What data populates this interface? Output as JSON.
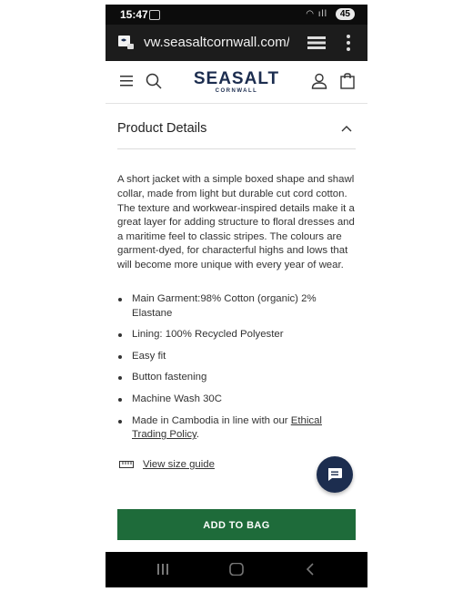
{
  "status_bar": {
    "time": "15:47",
    "battery": "45"
  },
  "browser": {
    "url": "vw.seasaltcornwall.com/t"
  },
  "logo": {
    "brand": "SEASALT",
    "sub": "CORNWALL"
  },
  "details": {
    "title": "Product Details",
    "description": "A short jacket with a simple boxed shape and shawl collar, made from light but durable cut cord cotton. The texture and workwear-inspired details make it a great layer for adding structure to floral dresses and a maritime feel to classic stripes. The colours are garment-dyed, for characterful highs and lows that will become more unique with every year of wear.",
    "specs": [
      "Main Garment:98% Cotton (organic) 2% Elastane",
      "Lining: 100% Recycled Polyester",
      "Easy fit",
      "Button fastening",
      "Machine Wash 30C"
    ],
    "made_in_prefix": "Made in Cambodia in line with our ",
    "made_in_link": "Ethical Trading Policy",
    "made_in_suffix": ".",
    "size_guide": "View size guide"
  },
  "cta": {
    "add_to_bag": "ADD TO BAG"
  },
  "colors": {
    "brand_navy": "#1c2d4f",
    "cta_green": "#1e6b3a"
  },
  "icons": {
    "browser": [
      "site-icon",
      "tabs-icon",
      "more-icon"
    ],
    "header": [
      "menu-icon",
      "search-icon",
      "account-icon",
      "bag-icon"
    ],
    "other": [
      "chevron-up-icon",
      "ruler-icon",
      "chat-icon",
      "recent-apps-icon",
      "home-icon",
      "back-icon"
    ]
  }
}
